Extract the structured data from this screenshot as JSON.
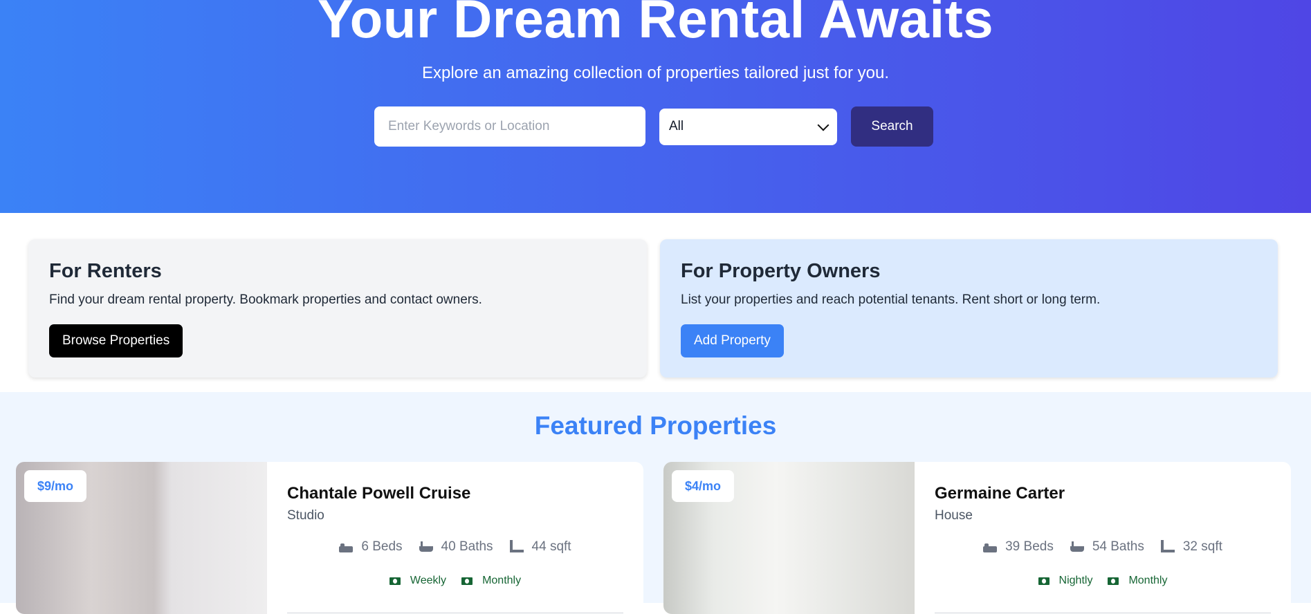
{
  "hero": {
    "title": "Your Dream Rental Awaits",
    "subtitle": "Explore an amazing collection of properties tailored just for you.",
    "search_placeholder": "Enter Keywords or Location",
    "type_select_value": "All",
    "search_button": "Search"
  },
  "renters": {
    "title": "For Renters",
    "text": "Find your dream rental property. Bookmark properties and contact owners.",
    "button": "Browse Properties"
  },
  "owners": {
    "title": "For Property Owners",
    "text": "List your properties and reach potential tenants. Rent short or long term.",
    "button": "Add Property"
  },
  "featured": {
    "title": "Featured Properties",
    "properties": [
      {
        "price": "$9/mo",
        "name": "Chantale Powell Cruise",
        "type": "Studio",
        "beds": "6 Beds",
        "baths": "40 Baths",
        "sqft": "44 sqft",
        "rates": [
          "Weekly",
          "Monthly"
        ]
      },
      {
        "price": "$4/mo",
        "name": "Germaine Carter",
        "type": "House",
        "beds": "39 Beds",
        "baths": "54 Baths",
        "sqft": "32 sqft",
        "rates": [
          "Nightly",
          "Monthly"
        ]
      }
    ]
  },
  "colors": {
    "hero_gradient_start": "#3b82f6",
    "hero_gradient_end": "#4f46e5",
    "accent": "#3b82f6",
    "search_button": "#312e81",
    "rate_green": "#166534"
  }
}
